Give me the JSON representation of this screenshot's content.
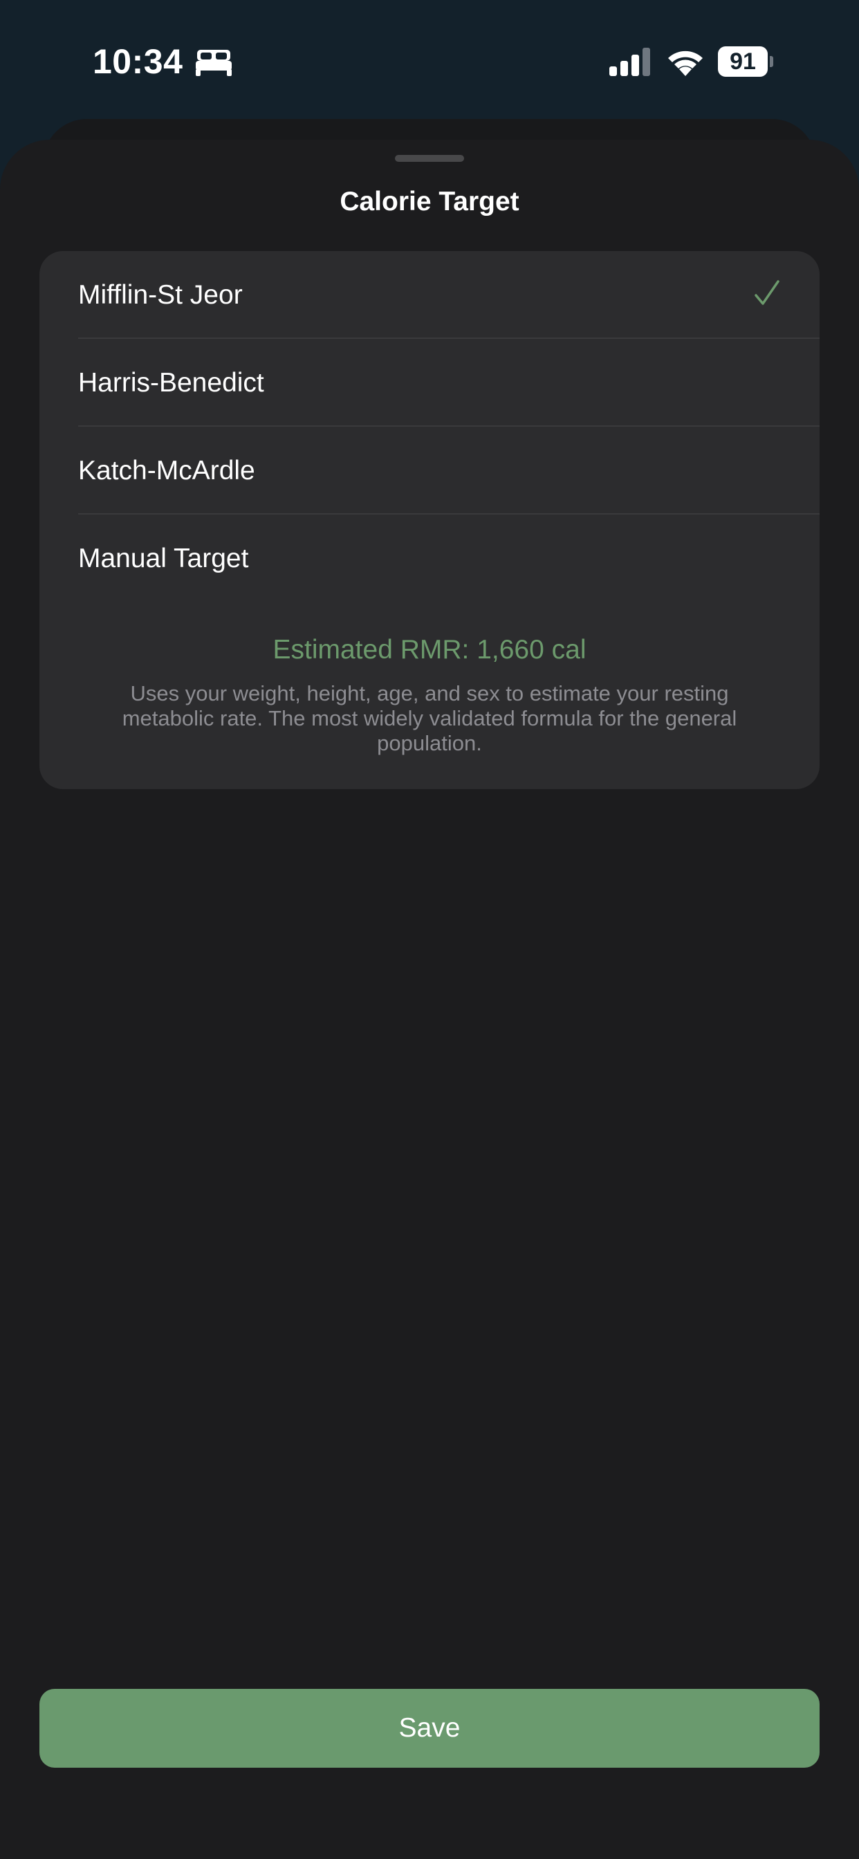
{
  "status_bar": {
    "time": "10:34",
    "battery_level": "91",
    "focus_icon": "bed-icon",
    "signal_icon": "cellular-signal-icon",
    "wifi_icon": "wifi-icon"
  },
  "sheet": {
    "title": "Calorie Target"
  },
  "options": [
    {
      "label": "Mifflin-St Jeor",
      "selected": true
    },
    {
      "label": "Harris-Benedict",
      "selected": false
    },
    {
      "label": "Katch-McArdle",
      "selected": false
    },
    {
      "label": "Manual Target",
      "selected": false
    }
  ],
  "info": {
    "rmr": "Estimated RMR: 1,660 cal",
    "description": "Uses your weight, height, age, and sex to estimate your resting metabolic rate. The most widely validated formula for the general population."
  },
  "actions": {
    "save_label": "Save"
  },
  "colors": {
    "accent": "#6a9a6e",
    "accent_text": "#6c9a6c",
    "sheet_background": "#1c1c1e",
    "card_background": "#2c2c2e",
    "status_background": "#13212b"
  }
}
